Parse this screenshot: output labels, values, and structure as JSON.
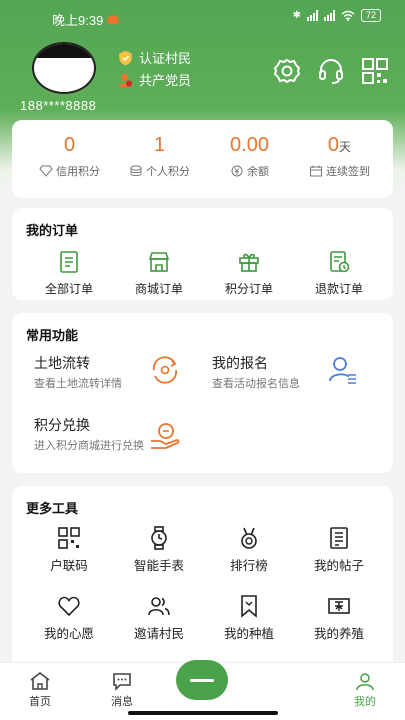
{
  "status_bar": {
    "time": "晚上9:39",
    "battery": "72"
  },
  "profile": {
    "phone": "188****8888",
    "badges": [
      {
        "label": "认证村民"
      },
      {
        "label": "共产党员"
      }
    ]
  },
  "header_icons": [
    "gear-icon",
    "headset-icon",
    "qrcode-icon"
  ],
  "stats": [
    {
      "value": "0",
      "unit": "",
      "label": "信用积分"
    },
    {
      "value": "1",
      "unit": "",
      "label": "个人积分"
    },
    {
      "value": "0.00",
      "unit": "",
      "label": "余额"
    },
    {
      "value": "0",
      "unit": "天",
      "label": "连续签到"
    }
  ],
  "orders": {
    "title": "我的订单",
    "items": [
      {
        "label": "全部订单",
        "icon": "document-icon"
      },
      {
        "label": "商城订单",
        "icon": "store-icon"
      },
      {
        "label": "积分订单",
        "icon": "gift-icon"
      },
      {
        "label": "退款订单",
        "icon": "refund-icon"
      }
    ]
  },
  "common": {
    "title": "常用功能",
    "items": [
      {
        "title": "土地流转",
        "sub": "查看土地流转详情",
        "icon": "cycle-icon"
      },
      {
        "title": "我的报名",
        "sub": "查看活动报名信息",
        "icon": "person-list-icon"
      },
      {
        "title": "积分兑换",
        "sub": "进入积分商城进行兑换",
        "icon": "exchange-icon"
      }
    ]
  },
  "tools": {
    "title": "更多工具",
    "items": [
      {
        "label": "户联码",
        "icon": "qrcode-icon"
      },
      {
        "label": "智能手表",
        "icon": "watch-icon"
      },
      {
        "label": "排行榜",
        "icon": "medal-icon"
      },
      {
        "label": "我的帖子",
        "icon": "post-icon"
      },
      {
        "label": "我的心愿",
        "icon": "heart-icon"
      },
      {
        "label": "邀请村民",
        "icon": "people-icon"
      },
      {
        "label": "我的种植",
        "icon": "bookmark-icon"
      },
      {
        "label": "我的养殖",
        "icon": "farm-icon"
      }
    ]
  },
  "tabbar": {
    "items": [
      {
        "label": "首页",
        "icon": "home-icon"
      },
      {
        "label": "消息",
        "icon": "message-icon"
      },
      {
        "label": "我的",
        "icon": "user-icon"
      }
    ]
  },
  "colors": {
    "brand_green": "#53a653",
    "accent_orange": "#e8752b"
  }
}
